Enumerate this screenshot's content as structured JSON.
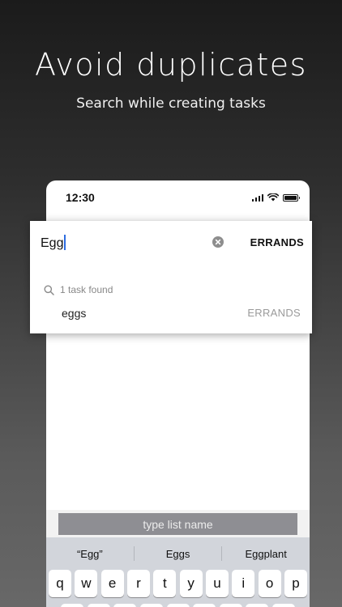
{
  "promo": {
    "headline": "Avoid duplicates",
    "subline": "Search while creating tasks"
  },
  "status_bar": {
    "time": "12:30"
  },
  "search": {
    "query": "Egg",
    "list_button": "ERRANDS",
    "result_count": "1 task found",
    "results": [
      {
        "name": "eggs",
        "list": "ERRANDS"
      }
    ]
  },
  "list_name_input": {
    "placeholder": "type list name"
  },
  "keyboard": {
    "suggestions": [
      "“Egg”",
      "Eggs",
      "Eggplant"
    ],
    "row1": [
      "q",
      "w",
      "e",
      "r",
      "t",
      "y",
      "u",
      "i",
      "o",
      "p"
    ]
  },
  "colors": {
    "caret": "#2d6cdf",
    "muted_text": "#9a9a9a",
    "list_input_bg": "#8e8e93"
  }
}
